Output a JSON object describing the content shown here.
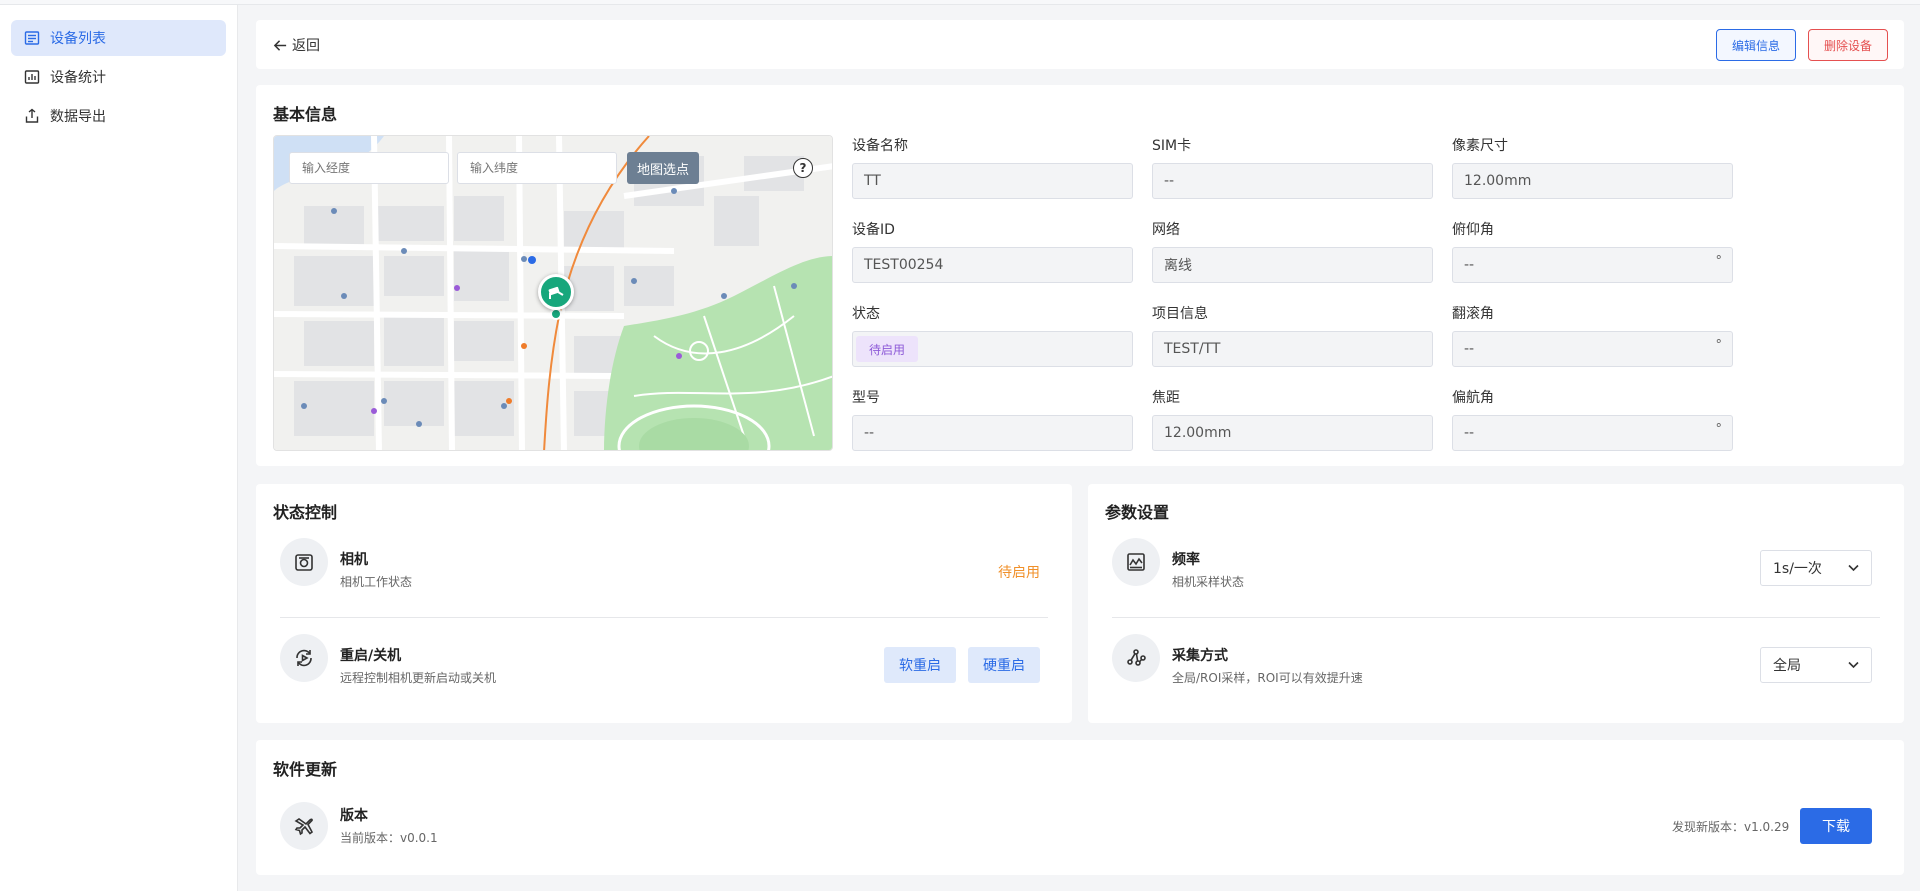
{
  "sidebar": {
    "items": [
      {
        "label": "设备列表",
        "icon": "list-icon",
        "active": true
      },
      {
        "label": "设备统计",
        "icon": "chart-icon",
        "active": false
      },
      {
        "label": "数据导出",
        "icon": "export-icon",
        "active": false
      }
    ]
  },
  "header": {
    "back_label": "返回",
    "edit_label": "编辑信息",
    "delete_label": "删除设备"
  },
  "basic_info": {
    "title": "基本信息",
    "map": {
      "lng_placeholder": "输入经度",
      "lat_placeholder": "输入纬度",
      "pick_label": "地图选点",
      "help": "?"
    },
    "fields": {
      "name": {
        "label": "设备名称",
        "value": "TT"
      },
      "sim": {
        "label": "SIM卡",
        "value": "--"
      },
      "pixel": {
        "label": "像素尺寸",
        "value": "12.00mm"
      },
      "device_id": {
        "label": "设备ID",
        "value": "TEST00254"
      },
      "network": {
        "label": "网络",
        "value": "离线"
      },
      "pitch": {
        "label": "俯仰角",
        "value": "--",
        "unit": "°"
      },
      "status": {
        "label": "状态",
        "value": "待启用"
      },
      "project": {
        "label": "项目信息",
        "value": "TEST/TT"
      },
      "roll": {
        "label": "翻滚角",
        "value": "--",
        "unit": "°"
      },
      "model": {
        "label": "型号",
        "value": "--"
      },
      "focal": {
        "label": "焦距",
        "value": "12.00mm"
      },
      "yaw": {
        "label": "偏航角",
        "value": "--",
        "unit": "°"
      }
    }
  },
  "status_control": {
    "title": "状态控制",
    "camera": {
      "title": "相机",
      "desc": "相机工作状态",
      "state": "待启用"
    },
    "power": {
      "title": "重启/关机",
      "desc": "远程控制相机更新启动或关机",
      "soft": "软重启",
      "hard": "硬重启"
    }
  },
  "params": {
    "title": "参数设置",
    "frequency": {
      "title": "频率",
      "desc": "相机采样状态",
      "value": "1s/一次"
    },
    "mode": {
      "title": "采集方式",
      "desc": "全局/ROI采样，ROI可以有效提升速",
      "value": "全局"
    }
  },
  "software": {
    "title": "软件更新",
    "version_title": "版本",
    "current": "当前版本：v0.0.1",
    "new_version": "发现新版本：v1.0.29",
    "download": "下载"
  },
  "colors": {
    "primary": "#2b6be6",
    "danger": "#e55050",
    "pending": "#f0902a",
    "marker": "#17a77c"
  }
}
